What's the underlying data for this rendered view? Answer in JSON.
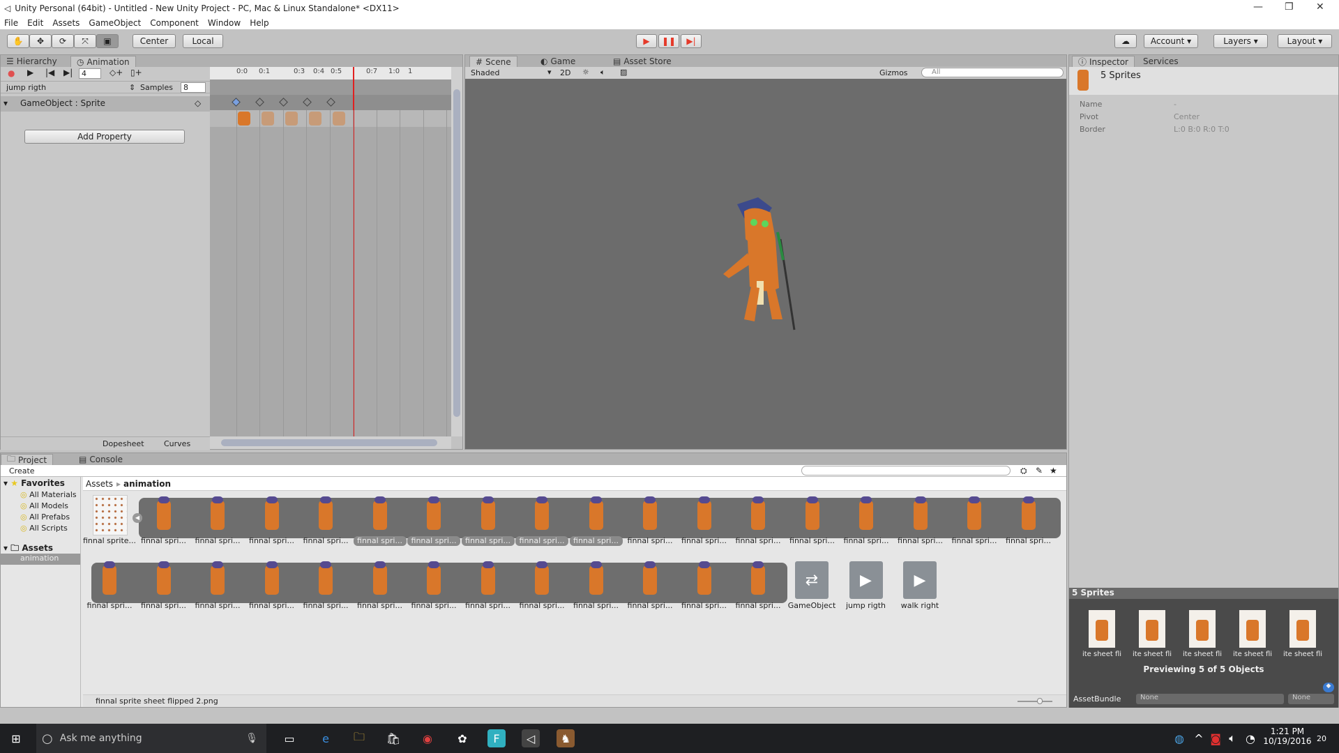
{
  "window": {
    "title": "Unity Personal (64bit) - Untitled - New Unity Project - PC, Mac & Linux Standalone* <DX11>"
  },
  "menu": [
    "File",
    "Edit",
    "Assets",
    "GameObject",
    "Component",
    "Window",
    "Help"
  ],
  "toolbar": {
    "center": "Center",
    "local": "Local",
    "account": "Account",
    "layers": "Layers",
    "layout": "Layout"
  },
  "animation": {
    "tabs": [
      "Hierarchy",
      "Animation"
    ],
    "frame": "4",
    "clip": "jump rigth",
    "samples_label": "Samples",
    "samples": "8",
    "track": "GameObject : Sprite",
    "add_property": "Add Property",
    "ruler": [
      "0:0",
      "0:1",
      "0:3",
      "0:4",
      "0:5",
      "0:7",
      "1:0",
      "1"
    ],
    "bottom_tabs": [
      "Dopesheet",
      "Curves"
    ],
    "current_time_marker": "0:5"
  },
  "scene": {
    "tabs": [
      "Scene",
      "Game",
      "Asset Store"
    ],
    "shading": "Shaded",
    "mode_2d": "2D",
    "gizmos": "Gizmos",
    "search": "All"
  },
  "inspector": {
    "tabs": [
      "Inspector",
      "Services"
    ],
    "header": "5 Sprites",
    "props": [
      {
        "k": "Name",
        "v": "-"
      },
      {
        "k": "Pivot",
        "v": "Center"
      },
      {
        "k": "Border",
        "v": "L:0 B:0 R:0 T:0"
      }
    ],
    "preview_title": "5 Sprites",
    "preview_labels": [
      "ite sheet fli",
      "ite sheet fli",
      "ite sheet fli",
      "ite sheet fli",
      "ite sheet fli"
    ],
    "preview_caption": "Previewing 5 of 5 Objects",
    "assetbundle_label": "AssetBundle",
    "assetbundle": "None",
    "variant": "None"
  },
  "project": {
    "tabs": [
      "Project",
      "Console"
    ],
    "create": "Create",
    "favorites": "Favorites",
    "fav_items": [
      "All Materials",
      "All Models",
      "All Prefabs",
      "All Scripts"
    ],
    "assets": "Assets",
    "folder": "animation",
    "breadcrumb": [
      "Assets",
      "animation"
    ],
    "row1": [
      {
        "label": "finnal sprite...",
        "sel": false,
        "sheet": true
      },
      {
        "label": "finnal spri...",
        "sel": false
      },
      {
        "label": "finnal spri...",
        "sel": false
      },
      {
        "label": "finnal spri...",
        "sel": false
      },
      {
        "label": "finnal spri...",
        "sel": false
      },
      {
        "label": "finnal spri...",
        "sel": true
      },
      {
        "label": "finnal spri...",
        "sel": true
      },
      {
        "label": "finnal spri...",
        "sel": true
      },
      {
        "label": "finnal spri...",
        "sel": true
      },
      {
        "label": "finnal spri...",
        "sel": true
      },
      {
        "label": "finnal spri...",
        "sel": false
      },
      {
        "label": "finnal spri...",
        "sel": false
      },
      {
        "label": "finnal spri...",
        "sel": false
      },
      {
        "label": "finnal spri...",
        "sel": false
      },
      {
        "label": "finnal spri...",
        "sel": false
      },
      {
        "label": "finnal spri...",
        "sel": false
      },
      {
        "label": "finnal spri...",
        "sel": false
      },
      {
        "label": "finnal spri...",
        "sel": false
      }
    ],
    "row2": [
      "finnal spri...",
      "finnal spri...",
      "finnal spri...",
      "finnal spri...",
      "finnal spri...",
      "finnal spri...",
      "finnal spri...",
      "finnal spri...",
      "finnal spri...",
      "finnal spri...",
      "finnal spri...",
      "finnal spri...",
      "finnal spri..."
    ],
    "others": [
      {
        "label": "GameObject",
        "icon": "animator-controller-icon"
      },
      {
        "label": "jump rigth",
        "icon": "animation-clip-icon"
      },
      {
        "label": "walk right",
        "icon": "animation-clip-icon"
      }
    ],
    "status": "finnal sprite sheet flipped 2.png"
  },
  "taskbar": {
    "search": "Ask me anything",
    "time": "1:21 PM",
    "date": "10/19/2016",
    "notifications": "20"
  },
  "colors": {
    "play": "#e53a2a",
    "timeline_cursor": "#e02020",
    "character": "#d9772a",
    "selection": "#8a8a8a"
  }
}
